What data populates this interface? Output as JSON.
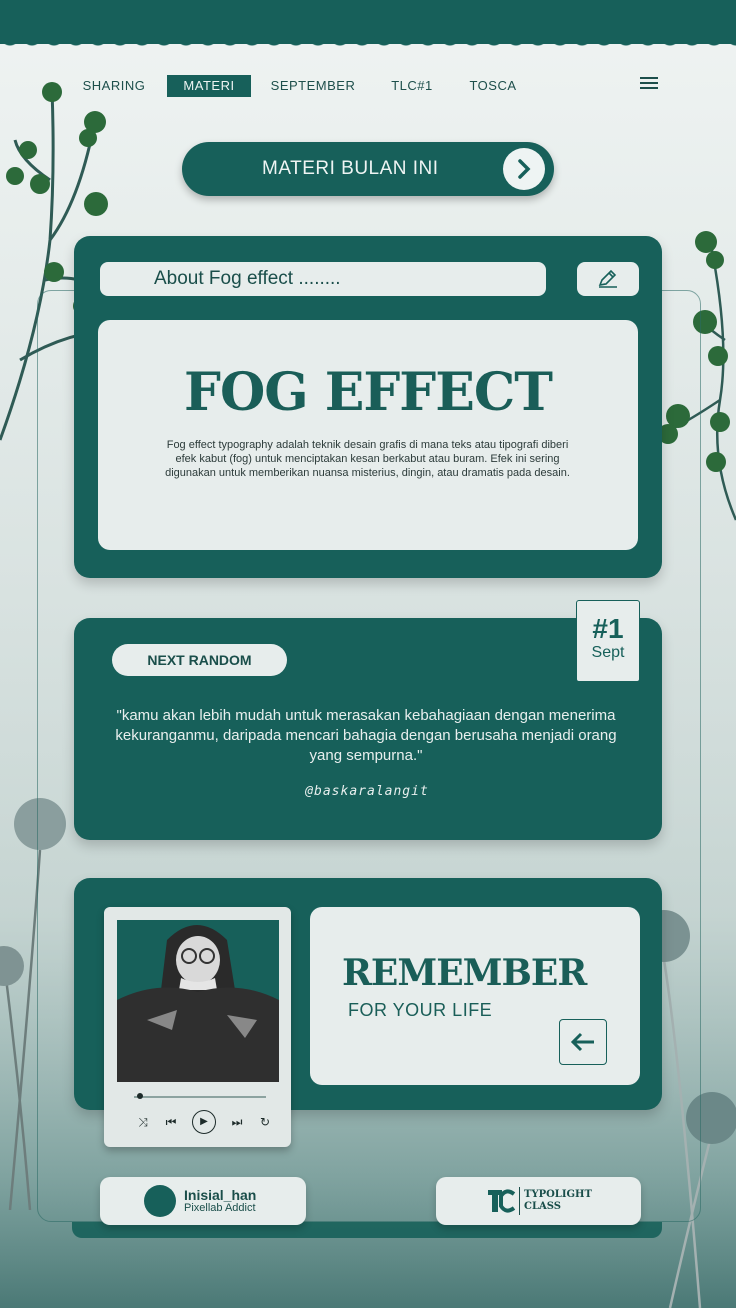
{
  "nav": {
    "items": [
      "SHARING",
      "MATERI",
      "SEPTEMBER",
      "TLC#1",
      "TOSCA"
    ],
    "active": "MATERI"
  },
  "header_pill": {
    "label": "MATERI BULAN INI"
  },
  "fog_card": {
    "search_text": "About Fog effect ........",
    "title": "FOG EFFECT",
    "description": "Fog effect typography adalah teknik desain grafis di mana teks atau tipografi diberi efek kabut (fog) untuk menciptakan kesan berkabut atau buram. Efek ini sering digunakan untuk memberikan nuansa misterius, dingin, atau dramatis pada desain."
  },
  "quote_card": {
    "button_label": "NEXT RANDOM",
    "badge_number": "#1",
    "badge_sub": "Sept",
    "quote": "\"kamu akan lebih mudah untuk merasakan kebahagiaan dengan menerima kekuranganmu, daripada mencari bahagia dengan berusaha menjadi orang yang sempurna.\"",
    "author": "@baskaralangit"
  },
  "remember_card": {
    "title": "REMEMBER",
    "subtitle": "FOR YOUR LIFE",
    "player_progress": 0.02
  },
  "footer": {
    "left_name": "Inisial_han",
    "left_sub": "Pixellab Addict",
    "right_line1": "TYPOLIGHT",
    "right_line2": "CLASS"
  },
  "colors": {
    "primary": "#17605a",
    "light": "#e7edec",
    "text_dark": "#1a4e4a"
  }
}
